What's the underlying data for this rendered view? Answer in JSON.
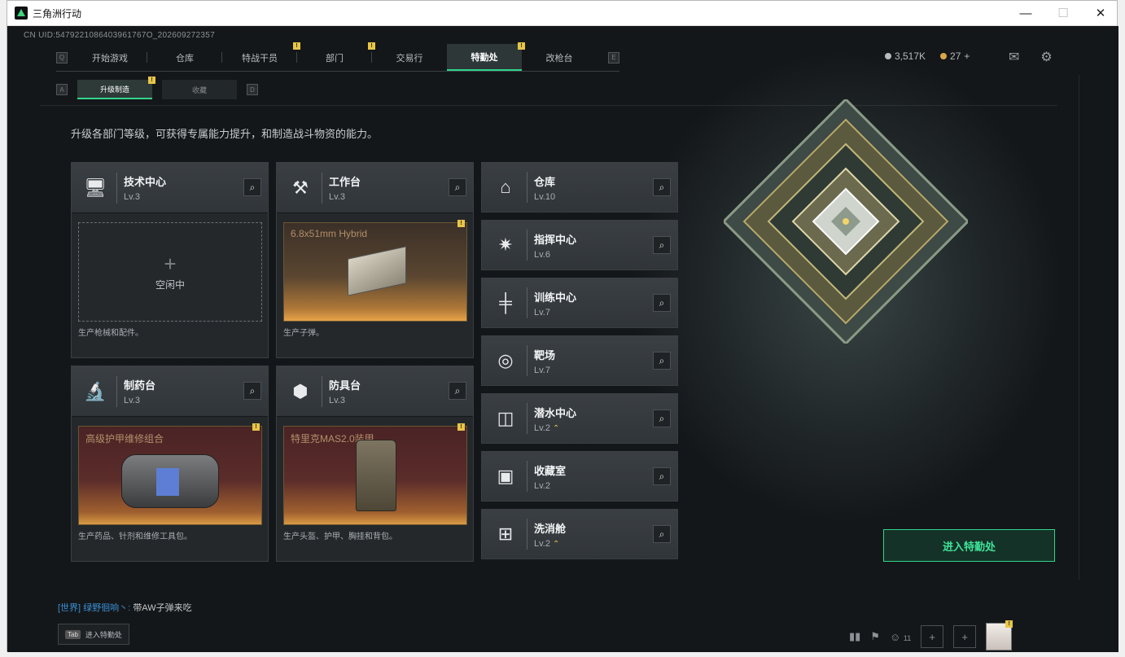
{
  "window": {
    "title": "三角洲行动",
    "controls": [
      "—",
      "☐",
      "✕"
    ]
  },
  "uid": "CN UID:5479221086403961767O_202609272357",
  "nav": {
    "left_key": "Q",
    "right_key": "E",
    "tabs": [
      {
        "label": "开始游戏",
        "notif": ""
      },
      {
        "label": "仓库",
        "notif": ""
      },
      {
        "label": "特战干员",
        "notif": "!"
      },
      {
        "label": "部门",
        "notif": "!"
      },
      {
        "label": "交易行",
        "notif": ""
      },
      {
        "label": "特勤处",
        "notif": "!",
        "active": true
      },
      {
        "label": "改枪台",
        "notif": ""
      }
    ]
  },
  "currency": {
    "coins": "3,517K",
    "tickets": "27",
    "plus": "+",
    "coin_color": "#b8bcbf",
    "ticket_color": "#d9a64a"
  },
  "topicons": {
    "mail": "mail-icon",
    "settings": "gear-icon"
  },
  "subnav": {
    "left_key": "A",
    "right_key": "D",
    "tabs": [
      {
        "label": "升级制造",
        "notif": "!"
      },
      {
        "label": "收藏",
        "notif": ""
      }
    ]
  },
  "description": "升级各部门等级，可获得专属能力提升，和制造战斗物资的能力。",
  "cards": [
    {
      "name": "技术中心",
      "level": "Lv.3",
      "icon": "computer-icon",
      "slot_state": "空闲中",
      "slot_plus": "+",
      "note": "生产枪械和配件。"
    },
    {
      "name": "工作台",
      "level": "Lv.3",
      "icon": "tools-icon",
      "product": "6.8x51mm Hybrid",
      "notif": "!",
      "note": "生产子弹。"
    },
    {
      "name": "制药台",
      "level": "Lv.3",
      "icon": "microscope-icon",
      "product": "高级护甲维修组合",
      "notif": "!",
      "note": "生产药品、针剂和维修工具包。"
    },
    {
      "name": "防具台",
      "level": "Lv.3",
      "icon": "armor-blocks-icon",
      "product": "特里克MAS2.0装甲",
      "notif": "!",
      "note": "生产头盔、护甲、胸挂和背包。"
    }
  ],
  "departments": [
    {
      "name": "仓库",
      "level": "Lv.10",
      "icon": "storage-icon",
      "upgrade": ""
    },
    {
      "name": "指挥中心",
      "level": "Lv.6",
      "icon": "command-icon",
      "upgrade": ""
    },
    {
      "name": "训练中心",
      "level": "Lv.7",
      "icon": "dumbbell-icon",
      "upgrade": ""
    },
    {
      "name": "靶场",
      "level": "Lv.7",
      "icon": "target-icon",
      "upgrade": ""
    },
    {
      "name": "潜水中心",
      "level": "Lv.2",
      "icon": "diving-mask-icon",
      "upgrade": "⌃"
    },
    {
      "name": "收藏室",
      "level": "Lv.2",
      "icon": "collection-icon",
      "upgrade": ""
    },
    {
      "name": "洗消舱",
      "level": "Lv.2",
      "icon": "decontamination-icon",
      "upgrade": "⌃"
    }
  ],
  "enter_button": "进入特勤处",
  "chat": {
    "channel": "[世界]",
    "user": "绿野徊响丶:",
    "message": "带AW子弹来吃"
  },
  "tab_hint": {
    "key": "Tab",
    "label": "进入特勤处"
  },
  "bottom": {
    "friends_count": "11"
  }
}
